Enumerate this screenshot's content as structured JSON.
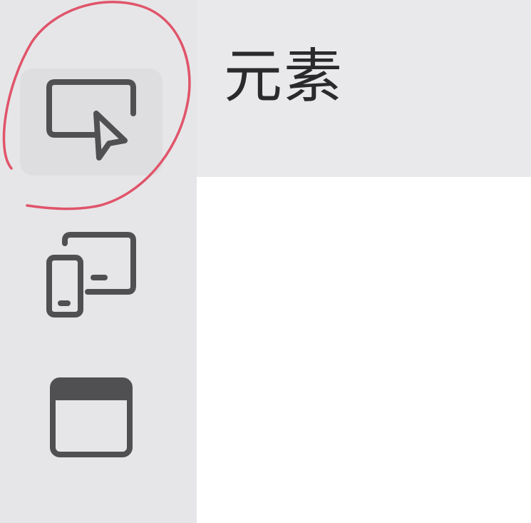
{
  "header": {
    "title": "元素"
  },
  "sidebar": {
    "items": [
      {
        "icon": "cursor-select-icon",
        "active": true
      },
      {
        "icon": "responsive-devices-icon",
        "active": false
      },
      {
        "icon": "window-icon",
        "active": false
      }
    ]
  },
  "colors": {
    "sidebar_bg": "#e6e6e8",
    "header_bg": "#e9e9eb",
    "content_bg": "#ffffff",
    "icon_stroke": "#505052",
    "annotation": "#e0546a"
  }
}
